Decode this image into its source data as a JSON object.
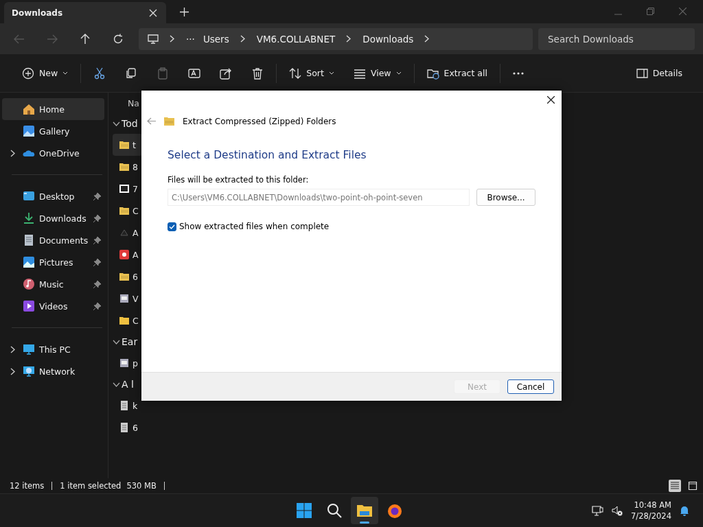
{
  "tabs": [
    {
      "label": "Downloads",
      "selected": true
    }
  ],
  "nav": [
    {
      "kind": "back",
      "disabled": true
    },
    {
      "kind": "forward",
      "disabled": true
    },
    {
      "kind": "up",
      "disabled": false
    },
    {
      "kind": "refresh",
      "disabled": false
    }
  ],
  "address": {
    "more": "···",
    "segments": [
      "Users",
      "VM6.COLLABNET",
      "Downloads"
    ]
  },
  "search": {
    "placeholder": "Search Downloads"
  },
  "toolbar": [
    {
      "kind": "new",
      "label": "New",
      "disabled": false
    },
    {
      "kind": "cut",
      "disabled": false
    },
    {
      "kind": "copy",
      "disabled": false
    },
    {
      "kind": "paste",
      "disabled": true
    },
    {
      "kind": "rename",
      "disabled": false
    },
    {
      "kind": "share",
      "disabled": false
    },
    {
      "kind": "delete",
      "disabled": false
    },
    {
      "kind": "sort",
      "label": "Sort",
      "disabled": false
    },
    {
      "kind": "view",
      "label": "View",
      "disabled": false
    },
    {
      "kind": "extract",
      "label": "Extract all",
      "disabled": false
    },
    {
      "kind": "more",
      "disabled": false
    }
  ],
  "details": {
    "label": "Details"
  },
  "sidebar": [
    [
      {
        "kind": "home",
        "label": "Home",
        "selected": true,
        "expandable": false,
        "pinned": false
      },
      {
        "kind": "gallery",
        "label": "Gallery",
        "selected": false,
        "expandable": false,
        "pinned": false
      },
      {
        "kind": "cloud",
        "label": "OneDrive",
        "selected": false,
        "expandable": true,
        "pinned": false
      }
    ],
    [
      {
        "kind": "desktop",
        "label": "Desktop",
        "selected": false,
        "expandable": false,
        "pinned": true
      },
      {
        "kind": "download",
        "label": "Downloads",
        "selected": false,
        "expandable": false,
        "pinned": true
      },
      {
        "kind": "document",
        "label": "Documents",
        "selected": false,
        "expandable": false,
        "pinned": true
      },
      {
        "kind": "pictures",
        "label": "Pictures",
        "selected": false,
        "expandable": false,
        "pinned": true
      },
      {
        "kind": "music",
        "label": "Music",
        "selected": false,
        "expandable": false,
        "pinned": true
      },
      {
        "kind": "video",
        "label": "Videos",
        "selected": false,
        "expandable": false,
        "pinned": true
      }
    ],
    [
      {
        "kind": "pc",
        "label": "This PC",
        "selected": false,
        "expandable": true,
        "pinned": false
      },
      {
        "kind": "network",
        "label": "Network",
        "selected": false,
        "expandable": true,
        "pinned": false
      }
    ]
  ],
  "files": {
    "column_header": "Na",
    "groups": [
      {
        "label": "Tod",
        "rows": [
          {
            "kind": "zip",
            "name": "t",
            "selected": true
          },
          {
            "kind": "zip",
            "name": "8",
            "selected": false
          },
          {
            "kind": "archive",
            "name": "7",
            "selected": false
          },
          {
            "kind": "zip",
            "name": "C",
            "selected": false
          },
          {
            "kind": "triangle",
            "name": "A",
            "selected": false
          },
          {
            "kind": "app",
            "name": "A",
            "selected": false
          },
          {
            "kind": "zip",
            "name": "6",
            "selected": false
          },
          {
            "kind": "installer",
            "name": "V",
            "selected": false
          },
          {
            "kind": "folder",
            "name": "C",
            "selected": false
          }
        ]
      },
      {
        "label": "Ear",
        "rows": [
          {
            "kind": "installer",
            "name": "p",
            "selected": false
          }
        ]
      },
      {
        "label": "A l",
        "rows": [
          {
            "kind": "document",
            "name": "k",
            "selected": false
          },
          {
            "kind": "document",
            "name": "6",
            "selected": false
          }
        ]
      }
    ]
  },
  "dialog": {
    "title": "Extract Compressed (Zipped) Folders",
    "heading": "Select a Destination and Extract Files",
    "field_label": "Files will be extracted to this folder:",
    "path": "C:\\Users\\VM6.COLLABNET\\Downloads\\two-point-oh-point-seven",
    "browse": "Browse...",
    "checkbox": {
      "label": "Show extracted files when complete",
      "checked": true
    },
    "buttons": [
      {
        "label": "Next",
        "disabled": true
      },
      {
        "label": "Cancel",
        "disabled": false
      }
    ]
  },
  "status": {
    "count": "12 items",
    "selection": "1 item selected",
    "size": "530 MB"
  },
  "views": [
    {
      "kind": "details",
      "selected": true
    },
    {
      "kind": "tiles",
      "selected": false
    }
  ],
  "taskbar": {
    "apps": [
      {
        "kind": "start",
        "active": false
      },
      {
        "kind": "search",
        "active": false
      },
      {
        "kind": "explorer",
        "active": true
      },
      {
        "kind": "firefox",
        "active": false
      }
    ],
    "time": "10:48 AM",
    "date": "7/28/2024"
  }
}
